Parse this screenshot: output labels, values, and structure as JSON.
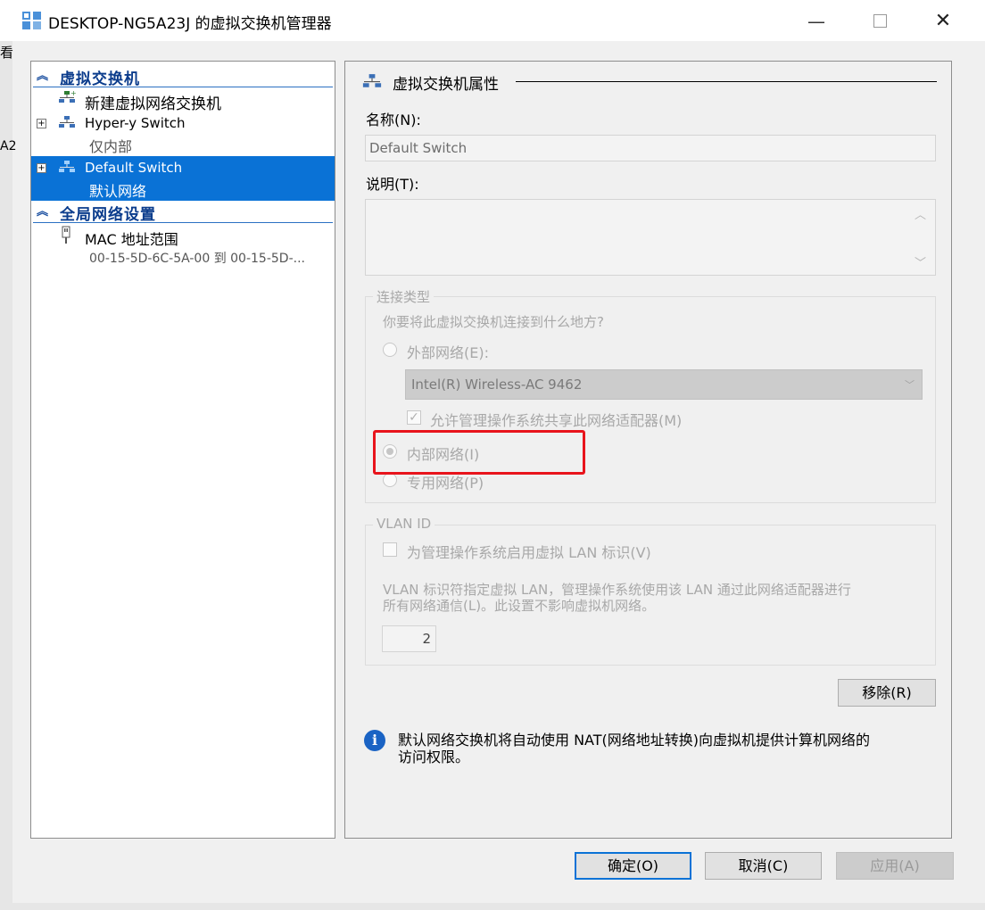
{
  "window": {
    "title": "DESKTOP-NG5A23J 的虚拟交换机管理器",
    "minimize_glyph": "—",
    "close_glyph": "✕"
  },
  "background": {
    "partial_char": "看",
    "partial_text": "A2"
  },
  "tree": {
    "section_vswitch": "虚拟交换机",
    "new_switch": "新建虚拟网络交换机",
    "switches": [
      {
        "name": "Hyper-y Switch",
        "type": "仅内部"
      },
      {
        "name": "Default Switch",
        "type": "默认网络"
      }
    ],
    "section_global": "全局网络设置",
    "mac_range_label": "MAC 地址范围",
    "mac_range_value": "00-15-5D-6C-5A-00 到 00-15-5D-..."
  },
  "props": {
    "header": "虚拟交换机属性",
    "name_label": "名称(N):",
    "name_value": "Default Switch",
    "desc_label": "说明(T):",
    "conn_group": "连接类型",
    "conn_question": "你要将此虚拟交换机连接到什么地方?",
    "external_label": "外部网络(E):",
    "adapter_value": "Intel(R) Wireless-AC 9462",
    "allow_mgmt_label": "允许管理操作系统共享此网络适配器(M)",
    "internal_label": "内部网络(I)",
    "private_label": "专用网络(P)",
    "vlan_group": "VLAN ID",
    "vlan_enable_label": "为管理操作系统启用虚拟 LAN 标识(V)",
    "vlan_desc_line1": "VLAN 标识符指定虚拟 LAN，管理操作系统使用该 LAN 通过此网络适配器进行",
    "vlan_desc_line2": "所有网络通信(L)。此设置不影响虚拟机网络。",
    "vlan_value": "2",
    "remove_button": "移除(R)",
    "info_line1": "默认网络交换机将自动使用 NAT(网络地址转换)向虚拟机提供计算机网络的",
    "info_line2": "访问权限。"
  },
  "footer": {
    "ok": "确定(O)",
    "cancel": "取消(C)",
    "apply": "应用(A)"
  },
  "colors": {
    "selection": "#0a72d6",
    "highlight_box": "#e8141c",
    "section_text": "#0b3c8c"
  }
}
